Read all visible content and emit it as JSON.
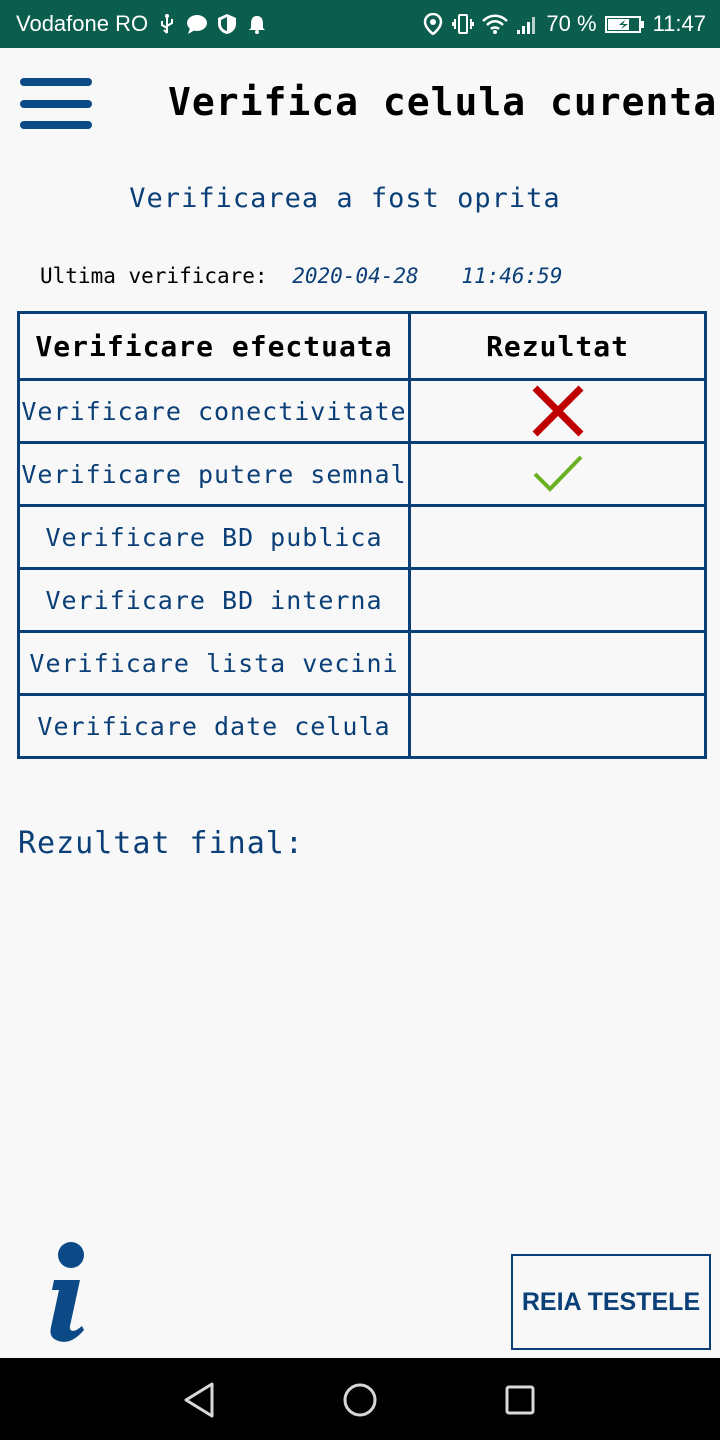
{
  "status_bar": {
    "carrier": "Vodafone RO",
    "battery": "70 %",
    "time": "11:47",
    "left_icons": [
      "usb-icon",
      "chat-bubble-icon",
      "shield-icon",
      "bell-icon"
    ],
    "right_icons": [
      "location-icon",
      "vibrate-icon",
      "wifi-icon",
      "signal-icon",
      "battery-icon"
    ]
  },
  "header": {
    "title": "Verifica celula curenta",
    "menu_icon": "hamburger-menu-icon"
  },
  "status_message": "Verificarea a fost oprita",
  "last_check": {
    "label": "Ultima verificare:",
    "date": "2020-04-28",
    "time": "11:46:59"
  },
  "table": {
    "headers": [
      "Verificare efectuata",
      "Rezultat"
    ],
    "rows": [
      {
        "label": "Verificare conectivitate",
        "result": "fail"
      },
      {
        "label": "Verificare putere semnal",
        "result": "pass"
      },
      {
        "label": "Verificare BD publica",
        "result": ""
      },
      {
        "label": "Verificare BD interna",
        "result": ""
      },
      {
        "label": "Verificare lista vecini",
        "result": ""
      },
      {
        "label": "Verificare date celula",
        "result": ""
      }
    ]
  },
  "final_result_label": "Rezultat final:",
  "buttons": {
    "rerun": "REIA TESTELE",
    "info_icon": "info-icon"
  },
  "colors": {
    "status_bar": "#0b5e4e",
    "primary": "#0b3f77",
    "fail": "#c00000",
    "pass": "#6ab023"
  },
  "nav": [
    "back-icon",
    "home-icon",
    "recents-icon"
  ]
}
